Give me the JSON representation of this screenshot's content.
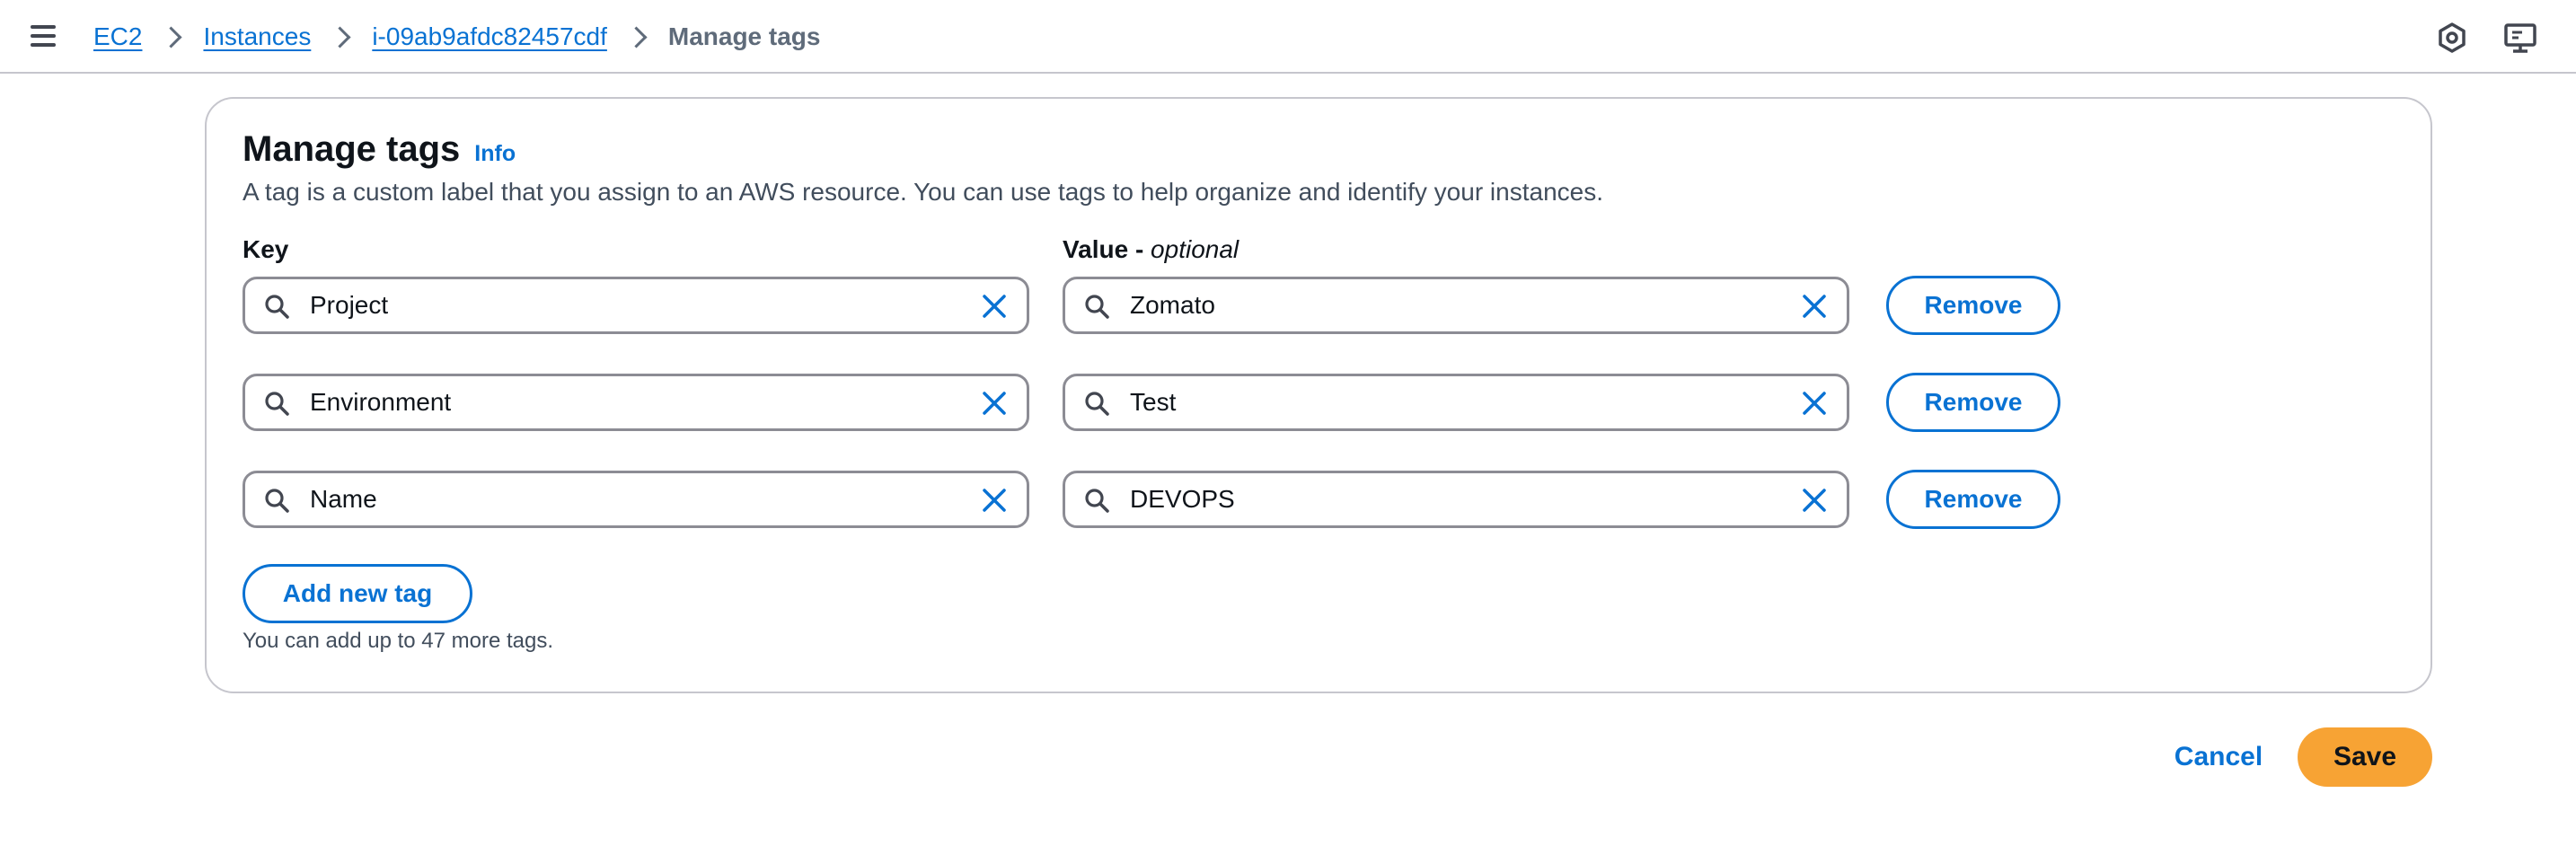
{
  "breadcrumb": {
    "items": [
      {
        "label": "EC2"
      },
      {
        "label": "Instances"
      },
      {
        "label": "i-09ab9afdc82457cdf"
      }
    ],
    "current": "Manage tags"
  },
  "page": {
    "title": "Manage tags",
    "info_label": "Info",
    "description": "A tag is a custom label that you assign to an AWS resource. You can use tags to help organize and identify your instances."
  },
  "columns": {
    "key_label": "Key",
    "value_label": "Value - ",
    "value_optional": "optional"
  },
  "tags": [
    {
      "key": "Project",
      "value": "Zomato",
      "remove_label": "Remove"
    },
    {
      "key": "Environment",
      "value": "Test",
      "remove_label": "Remove"
    },
    {
      "key": "Name",
      "value": "DEVOPS",
      "remove_label": "Remove"
    }
  ],
  "actions": {
    "add_label": "Add new tag",
    "hint": "You can add up to 47 more tags.",
    "cancel_label": "Cancel",
    "save_label": "Save"
  },
  "icons": {
    "menu": "hamburger-menu-icon",
    "top_right_1": "settings-hexagon-icon",
    "top_right_2": "feedback-screen-icon",
    "search": "search-icon",
    "clear": "clear-x-icon"
  },
  "colors": {
    "link": "#0972d3",
    "primary_button": "#f7a334",
    "border": "#c6c6cd",
    "input_border": "#8c8c94"
  }
}
